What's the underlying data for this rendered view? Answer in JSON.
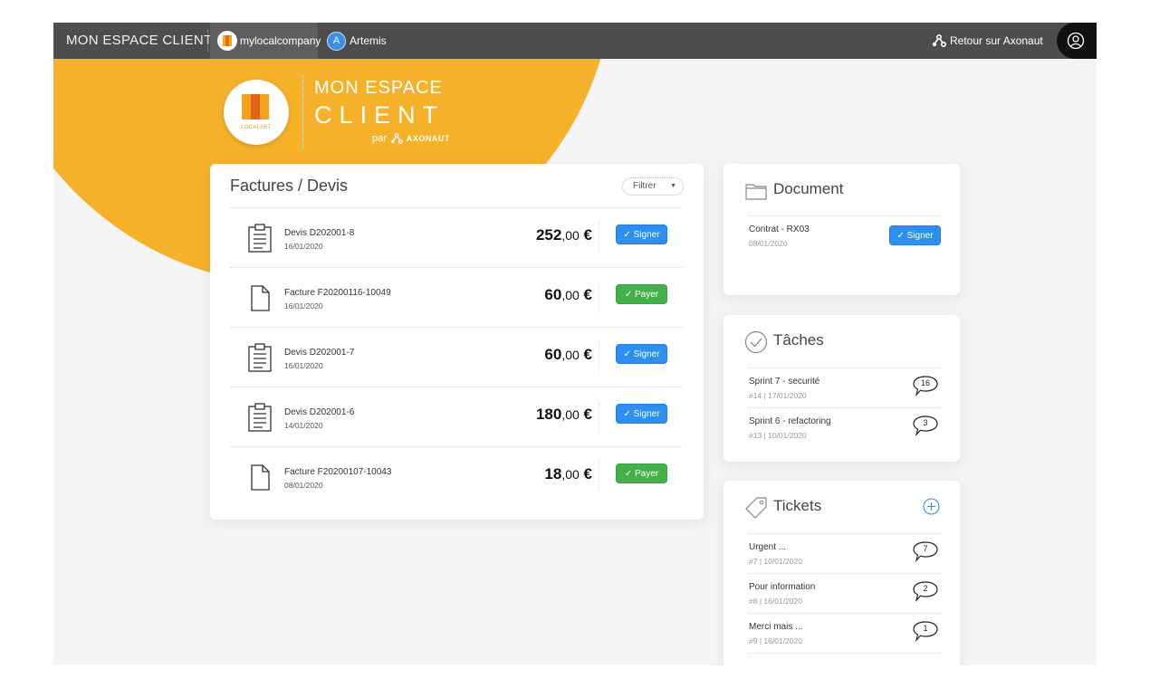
{
  "topbar": {
    "app_title": "MON ESPACE CLIENT",
    "company": "mylocalcompany",
    "user_initial": "A",
    "user_name": "Artemis",
    "back_link": "Retour sur Axonaut"
  },
  "brand": {
    "line1": "MON ESPACE",
    "line2": "CLIENT",
    "par": "par",
    "axonaut": "AXONAUT",
    "logo_text": "LOCALSET"
  },
  "invoices": {
    "title": "Factures / Devis",
    "filter_label": "Filtrer",
    "rows": [
      {
        "type": "devis",
        "label": "Devis D202001-8",
        "date": "16/01/2020",
        "amount_int": "252",
        "amount_dec": ",00",
        "currency": " €",
        "action": "Signer"
      },
      {
        "type": "facture",
        "label": "Facture F20200116-10049",
        "date": "16/01/2020",
        "amount_int": "60",
        "amount_dec": ",00",
        "currency": " €",
        "action": "Payer"
      },
      {
        "type": "devis",
        "label": "Devis D202001-7",
        "date": "16/01/2020",
        "amount_int": "60",
        "amount_dec": ",00",
        "currency": " €",
        "action": "Signer"
      },
      {
        "type": "devis",
        "label": "Devis D202001-6",
        "date": "14/01/2020",
        "amount_int": "180",
        "amount_dec": ",00",
        "currency": " €",
        "action": "Signer"
      },
      {
        "type": "facture",
        "label": "Facture F20200107-10043",
        "date": "08/01/2020",
        "amount_int": "18",
        "amount_dec": ",00",
        "currency": " €",
        "action": "Payer"
      }
    ]
  },
  "document": {
    "title": "Document",
    "item_label": "Contrat - RX03",
    "item_date": "08/01/2020",
    "action": "Signer"
  },
  "tasks": {
    "title": "Tâches",
    "items": [
      {
        "label": "Sprint 7 - securité",
        "meta": "#14 | 17/01/2020",
        "count": "16"
      },
      {
        "label": "Sprint 6 - refactoring",
        "meta": "#13 | 10/01/2020",
        "count": "3"
      }
    ]
  },
  "tickets": {
    "title": "Tickets",
    "items": [
      {
        "label": "Urgent ...",
        "meta": "#7 | 10/01/2020",
        "count": "7"
      },
      {
        "label": "Pour information",
        "meta": "#8 | 16/01/2020",
        "count": "2"
      },
      {
        "label": "Merci mais ...",
        "meta": "#9 | 16/01/2020",
        "count": "1"
      }
    ]
  },
  "colors": {
    "topbar": "#4d4d4d",
    "accent_orange": "#f6b12b",
    "sign_blue": "#2d8ff0",
    "pay_green": "#43b04a"
  },
  "icons": {
    "devis": "clipboard-icon",
    "facture": "document-icon",
    "document": "folder-icon",
    "tasks": "check-circle-icon",
    "tickets": "tag-icon",
    "count": "speech-bubble-icon"
  }
}
